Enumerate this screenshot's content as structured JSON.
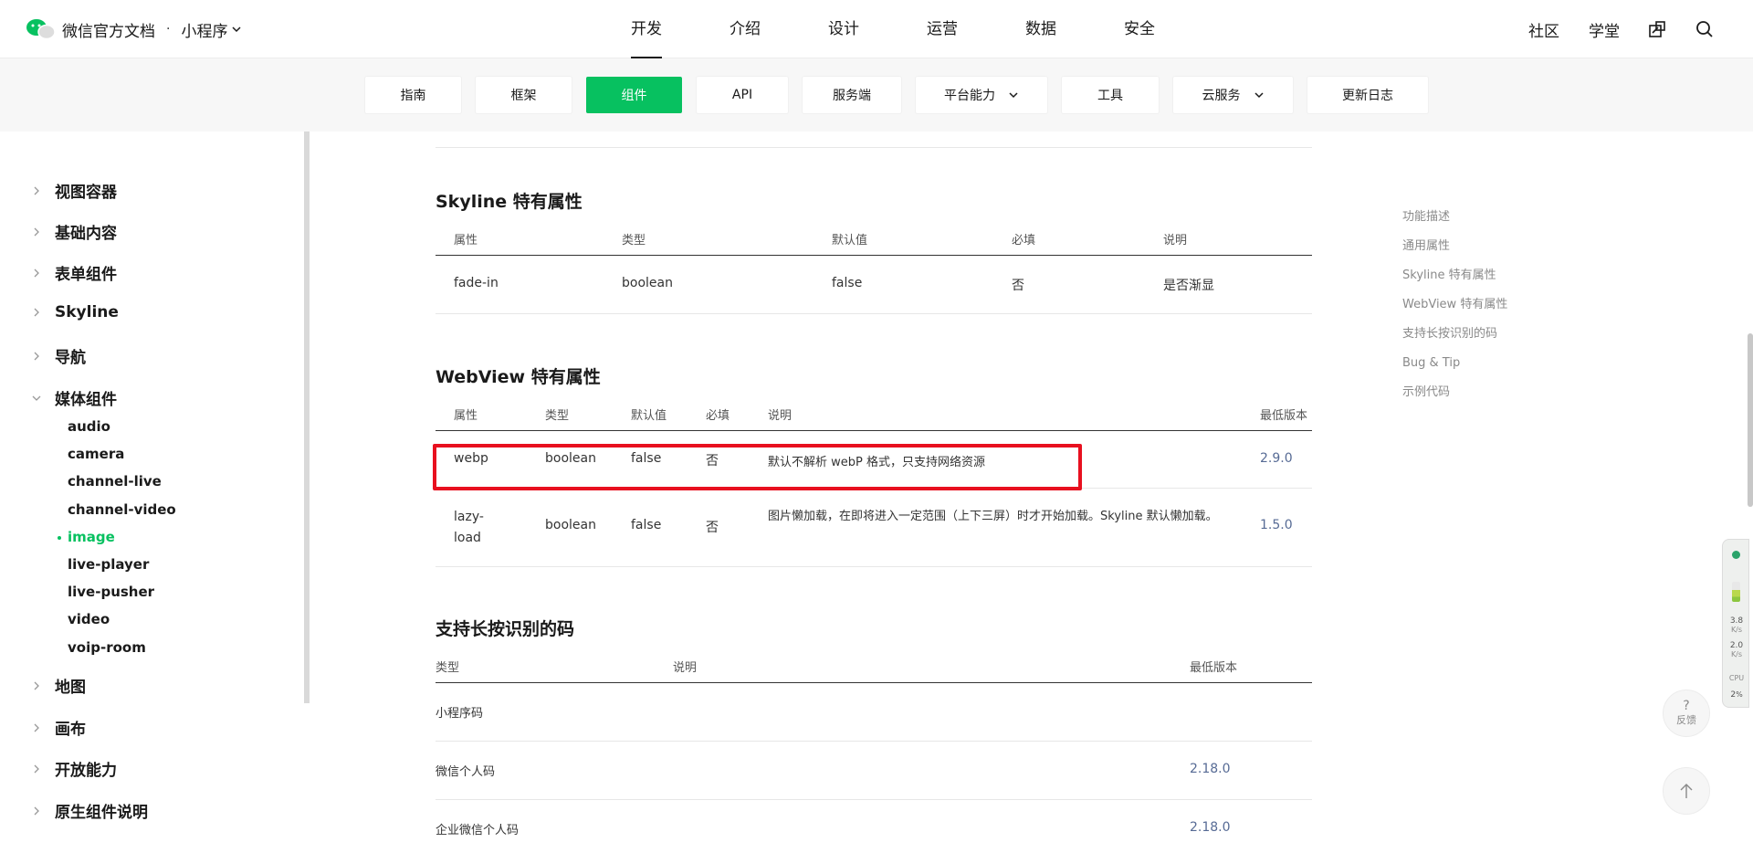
{
  "header": {
    "brand_name": "微信官方文档",
    "brand_dot": "·",
    "brand_sub": "小程序",
    "nav": [
      "开发",
      "介绍",
      "设计",
      "运营",
      "数据",
      "安全"
    ],
    "active_nav": "开发",
    "right_links": [
      "社区",
      "学堂"
    ]
  },
  "subnav": {
    "items": [
      {
        "label": "指南"
      },
      {
        "label": "框架"
      },
      {
        "label": "组件"
      },
      {
        "label": "API"
      },
      {
        "label": "服务端"
      },
      {
        "label": "平台能力"
      },
      {
        "label": "工具"
      },
      {
        "label": "云服务"
      },
      {
        "label": "更新日志"
      }
    ],
    "active": "组件"
  },
  "sidebar": {
    "groups": [
      {
        "label": "视图容器"
      },
      {
        "label": "基础内容"
      },
      {
        "label": "表单组件"
      },
      {
        "label": "Skyline"
      },
      {
        "label": "导航"
      },
      {
        "label": "媒体组件"
      },
      {
        "label": "地图"
      },
      {
        "label": "画布"
      },
      {
        "label": "开放能力"
      },
      {
        "label": "原生组件说明"
      }
    ],
    "media_items": [
      {
        "label": "audio"
      },
      {
        "label": "camera"
      },
      {
        "label": "channel-live"
      },
      {
        "label": "channel-video"
      },
      {
        "label": "image"
      },
      {
        "label": "live-player"
      },
      {
        "label": "live-pusher"
      },
      {
        "label": "video"
      },
      {
        "label": "voip-room"
      }
    ],
    "active_item": "image"
  },
  "skyline_section": {
    "title": "Skyline 特有属性",
    "headers": [
      "属性",
      "类型",
      "默认值",
      "必填",
      "说明"
    ],
    "rows": [
      [
        "fade-in",
        "boolean",
        "false",
        "否",
        "是否渐显"
      ]
    ]
  },
  "webview_section": {
    "title": "WebView 特有属性",
    "headers": [
      "属性",
      "类型",
      "默认值",
      "必填",
      "说明",
      "最低版本"
    ],
    "rows": [
      [
        "webp",
        "boolean",
        "false",
        "否",
        "默认不解析 webP 格式，只支持网络资源",
        "2.9.0"
      ],
      [
        "lazy-load",
        "boolean",
        "false",
        "否",
        "图片懒加载，在即将进入一定范围（上下三屏）时才开始加载。Skyline 默认懒加载。",
        "1.5.0"
      ]
    ]
  },
  "code_section": {
    "title": "支持长按识别的码",
    "headers": [
      "类型",
      "说明",
      "最低版本"
    ],
    "rows": [
      [
        "小程序码",
        "",
        ""
      ],
      [
        "微信个人码",
        "",
        "2.18.0"
      ],
      [
        "企业微信个人码",
        "",
        "2.18.0"
      ]
    ]
  },
  "toc": [
    "功能描述",
    "通用属性",
    "Skyline 特有属性",
    "WebView 特有属性",
    "支持长按识别的码",
    "Bug & Tip",
    "示例代码"
  ],
  "widget": {
    "up_value": "3.8",
    "up_unit": "K/s",
    "down_value": "2.0",
    "down_unit": "K/s",
    "cpu_label": "CPU",
    "cpu_value": "2",
    "cpu_unit": "%"
  },
  "feedback": {
    "symbol": "?",
    "label": "反馈"
  },
  "colors": {
    "accent": "#07c160",
    "highlight": "#e8101f",
    "link": "#576b95"
  }
}
